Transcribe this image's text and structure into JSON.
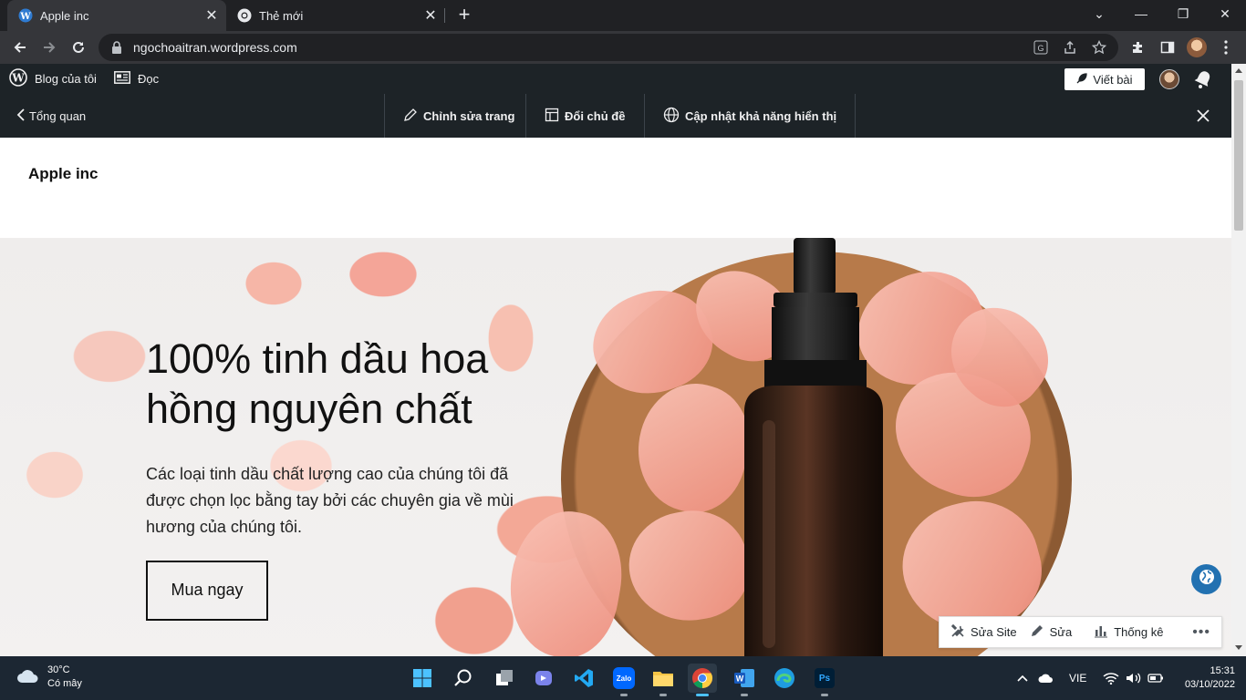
{
  "browser": {
    "tabs": [
      {
        "title": "Apple inc",
        "active": true
      },
      {
        "title": "Thẻ mới",
        "active": false
      }
    ],
    "url": "ngochoaitran.wordpress.com"
  },
  "wp_admin_bar": {
    "my_blog": "Blog của tôi",
    "reader": "Đọc",
    "write_post": "Viết bài"
  },
  "edit_bar": {
    "back": "Tổng quan",
    "edit_page": "Chỉnh sửa trang",
    "change_theme": "Đổi chủ đề",
    "update_visibility": "Cập nhật khả năng hiển thị"
  },
  "site": {
    "title": "Apple inc",
    "hero": {
      "heading": "100% tinh dầu hoa hồng nguyên chất",
      "description": "Các loại tinh dầu chất lượng cao của chúng tôi đã được chọn lọc bằng tay bởi các chuyên gia về mùi hương của chúng tôi.",
      "button": "Mua ngay"
    }
  },
  "action_bar": {
    "edit_site": "Sửa Site",
    "edit": "Sửa",
    "stats": "Thống kê"
  },
  "taskbar": {
    "weather_temp": "30°C",
    "weather_desc": "Có mây",
    "language": "VIE",
    "time": "15:31",
    "date": "03/10/2022"
  },
  "colors": {
    "wp_dark": "#1d2327",
    "browser_dark": "#202124",
    "accent_blue": "#2271b1",
    "taskbar": "#1c2733"
  }
}
